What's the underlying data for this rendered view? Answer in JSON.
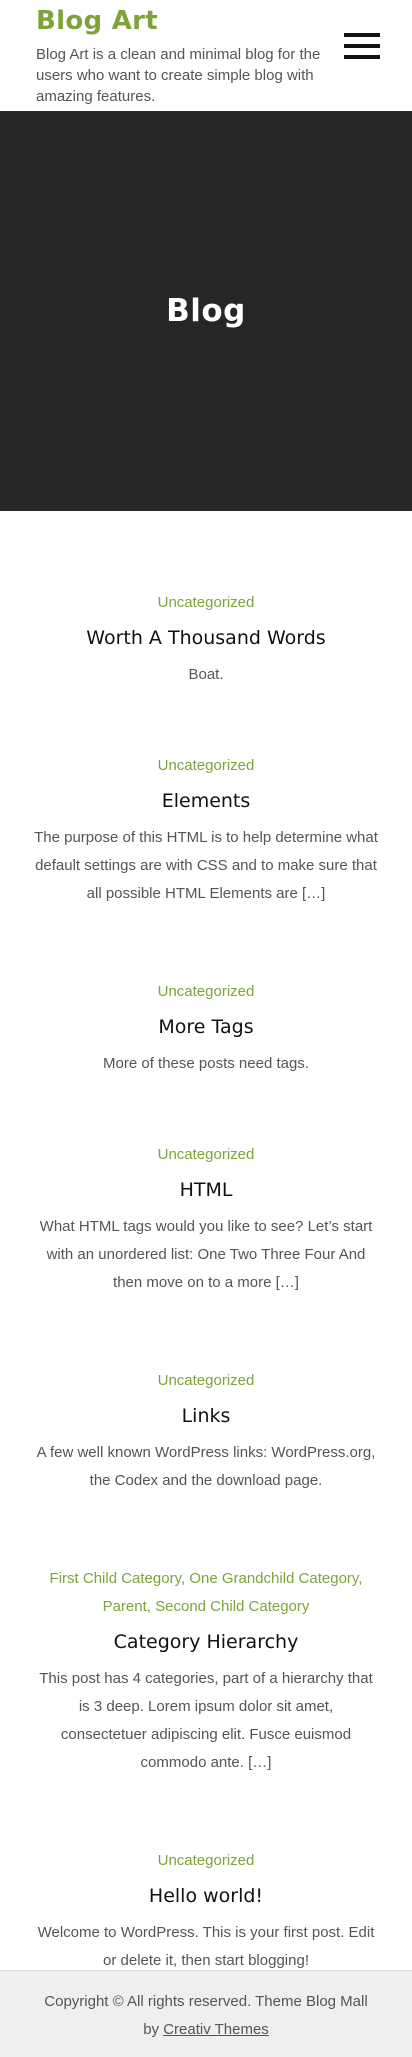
{
  "header": {
    "site_title": "Blog Art",
    "tagline": "Blog Art is a clean and minimal blog for the users who want to create simple blog with amazing features.",
    "menu_icon": "hamburger-menu-icon"
  },
  "hero": {
    "title": "Blog"
  },
  "posts": [
    {
      "categories": [
        "Uncategorized"
      ],
      "title": "Worth A Thousand Words",
      "excerpt": "Boat."
    },
    {
      "categories": [
        "Uncategorized"
      ],
      "title": "Elements",
      "excerpt": "The purpose of this HTML is to help determine what default settings are with CSS and to make sure that all possible HTML Elements are […]"
    },
    {
      "categories": [
        "Uncategorized"
      ],
      "title": "More Tags",
      "excerpt": "More of these posts need tags."
    },
    {
      "categories": [
        "Uncategorized"
      ],
      "title": "HTML",
      "excerpt": "What HTML tags would you like to see? Let’s start with an unordered list: One Two Three Four And then move on to a more […]"
    },
    {
      "categories": [
        "Uncategorized"
      ],
      "title": "Links",
      "excerpt": "A few well known WordPress links: WordPress.org, the Codex and the download page."
    },
    {
      "categories": [
        "First Child Category",
        "One Grandchild Category",
        "Parent",
        "Second Child Category"
      ],
      "title": "Category Hierarchy",
      "excerpt": "This post has 4 categories, part of a hierarchy that is 3 deep. Lorem ipsum dolor sit amet, consectetuer adipiscing elit. Fusce euismod commodo ante. […]"
    },
    {
      "categories": [
        "Uncategorized"
      ],
      "title": "Hello world!",
      "excerpt": "Welcome to WordPress. This is your first post. Edit or delete it, then start blogging!"
    }
  ],
  "footer": {
    "copyright": "Copyright © All rights reserved. Theme Blog Mall",
    "by": "by",
    "author_link": "Creativ Themes"
  },
  "colors": {
    "accent": "#7ea33a",
    "hero_bg": "#262626",
    "footer_bg": "#efefef",
    "text": "#555555",
    "heading": "#111111"
  }
}
